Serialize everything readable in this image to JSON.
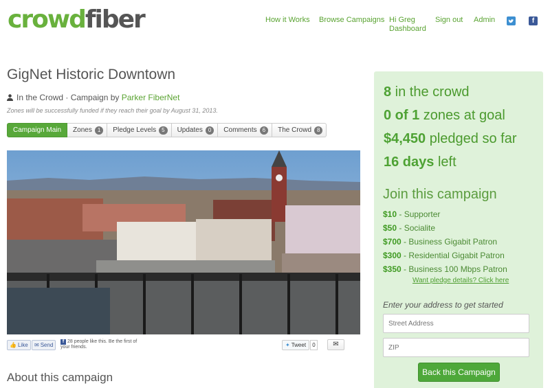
{
  "header": {
    "logo_part1": "crowd",
    "logo_part2": "fiber",
    "nav": {
      "how_it_works": "How it Works",
      "browse": "Browse Campaigns",
      "greeting": "Hi Greg",
      "dashboard": "Dashboard",
      "sign_out": "Sign out",
      "admin": "Admin"
    },
    "social_icons": [
      "twitter-icon",
      "facebook-icon"
    ]
  },
  "campaign": {
    "title": "GigNet Historic Downtown",
    "status": "In the Crowd",
    "by_prefix": " · Campaign by ",
    "organizer": "Parker FiberNet",
    "note": "Zones will be successfully funded if they reach their goal by August 31, 2013."
  },
  "tabs": [
    {
      "label": "Campaign Main",
      "active": true
    },
    {
      "label": "Zones",
      "count": "1"
    },
    {
      "label": "Pledge Levels",
      "count": "5"
    },
    {
      "label": "Updates",
      "count": "0"
    },
    {
      "label": "Comments",
      "count": "6"
    },
    {
      "label": "The Crowd",
      "count": "8"
    }
  ],
  "share": {
    "like": "Like",
    "send": "Send",
    "fb_text": "28 people like this. Be the first of your friends.",
    "tweet": "Tweet",
    "tweet_count": "0"
  },
  "about_heading": "About this campaign",
  "stats": {
    "crowd_value": "8",
    "crowd_label": " in the crowd",
    "zones_value": "0 of 1",
    "zones_label": " zones at goal",
    "pledged_value": "$4,450",
    "pledged_label": " pledged so far",
    "days_value": "16 days",
    "days_label": " left"
  },
  "join": {
    "heading": "Join this campaign",
    "levels": [
      {
        "amount": "$10",
        "name": " - Supporter"
      },
      {
        "amount": "$50",
        "name": " - Socialite"
      },
      {
        "amount": "$700",
        "name": " - Business Gigabit Patron"
      },
      {
        "amount": "$300",
        "name": " - Residential Gigabit Patron"
      },
      {
        "amount": "$350",
        "name": " - Business 100 Mbps Patron"
      }
    ],
    "details_link": "Want pledge details? Click here",
    "address_label": "Enter your address to get started",
    "street_placeholder": "Street Address",
    "zip_placeholder": "ZIP",
    "button": "Back this Campaign"
  },
  "colors": {
    "brand_green": "#69b13d",
    "panel_bg": "#dff2da",
    "button_green": "#4ea83a"
  }
}
